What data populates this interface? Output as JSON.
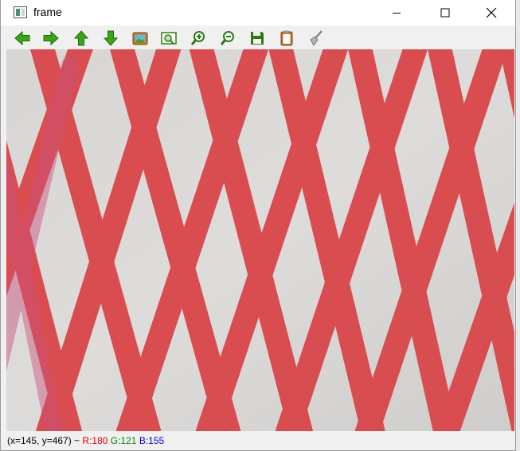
{
  "window": {
    "title": "frame",
    "icon": "app-window-icon",
    "controls": [
      "minimize-icon",
      "maximize-icon",
      "close-icon"
    ]
  },
  "toolbar": {
    "tools": [
      {
        "name": "pan-left",
        "icon": "arrow-left-icon",
        "color": "#3aa514"
      },
      {
        "name": "pan-right",
        "icon": "arrow-right-icon",
        "color": "#3aa514"
      },
      {
        "name": "pan-up",
        "icon": "arrow-up-icon",
        "color": "#3aa514"
      },
      {
        "name": "pan-down",
        "icon": "arrow-down-icon",
        "color": "#3aa514"
      },
      {
        "name": "zoom-original",
        "icon": "picture-icon",
        "color": "#c77a2a"
      },
      {
        "name": "zoom-fit",
        "icon": "zoom-fit-icon",
        "color": "#3aa514"
      },
      {
        "name": "zoom-in",
        "icon": "zoom-in-icon",
        "color": "#2d7a12"
      },
      {
        "name": "zoom-out",
        "icon": "zoom-out-icon",
        "color": "#2d7a12"
      },
      {
        "name": "save",
        "icon": "floppy-disk-icon",
        "color": "#2d7a12"
      },
      {
        "name": "properties",
        "icon": "clipboard-icon",
        "color": "#c77a2a"
      },
      {
        "name": "clear",
        "icon": "brush-icon",
        "color": "#9a9a9a"
      }
    ]
  },
  "image": {
    "description_icon": "red-net-mesh-image",
    "mesh_color": "#d9464a",
    "background_color": "#d6d4d2"
  },
  "status": {
    "coords": "(x=145, y=467) ~ ",
    "r": "R:180",
    "g": "G:121",
    "b": "B:155",
    "r_color": "#e00000",
    "g_color": "#008a00",
    "b_color": "#0000e0"
  }
}
